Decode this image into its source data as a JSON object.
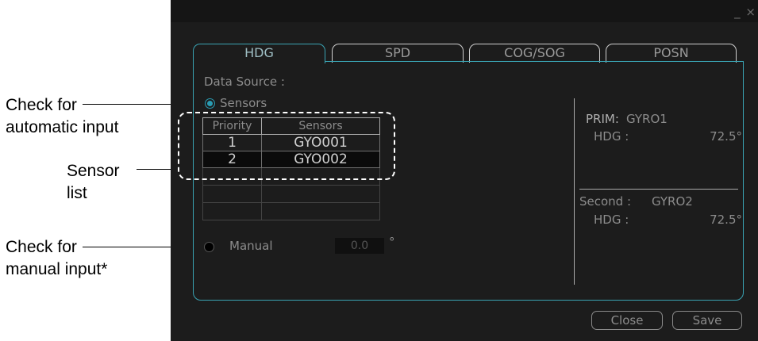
{
  "callouts": {
    "auto_line1": "Check for",
    "auto_line2": "automatic input",
    "sensor_line1": "Sensor",
    "sensor_line2": "list",
    "manual_line1": "Check for",
    "manual_line2": "manual input*"
  },
  "window": {
    "controls": "_ ×"
  },
  "tabs": [
    {
      "label": "HDG",
      "active": true
    },
    {
      "label": "SPD",
      "active": false
    },
    {
      "label": "COG/SOG",
      "active": false
    },
    {
      "label": "POSN",
      "active": false
    }
  ],
  "data_source": {
    "label": "Data Source :",
    "sensors_option": "Sensors",
    "sensors_selected": true,
    "manual_option": "Manual",
    "manual_selected": false,
    "manual_value": "0.0",
    "manual_unit": "°"
  },
  "sensor_table": {
    "headers": [
      "Priority",
      "Sensors"
    ],
    "rows": [
      {
        "priority": "1",
        "sensor": "GYO001"
      },
      {
        "priority": "2",
        "sensor": "GYO002"
      }
    ]
  },
  "primary": {
    "label": "PRIM:",
    "sensor": "GYRO1",
    "hdg_label": "HDG :",
    "hdg_value": "72.5°"
  },
  "second": {
    "label": "Second :",
    "sensor": "GYRO2",
    "hdg_label": "HDG :",
    "hdg_value": "72.5°"
  },
  "buttons": {
    "close": "Close",
    "save": "Save"
  },
  "colors": {
    "accent": "#3aa3b3",
    "background": "#1c1c1c"
  }
}
